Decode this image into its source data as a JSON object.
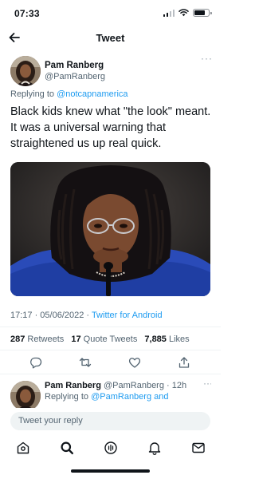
{
  "status_bar": {
    "time": "07:33"
  },
  "header": {
    "title": "Tweet"
  },
  "tweet": {
    "author_name": "Pam Ranberg",
    "author_handle": "@PamRanberg",
    "more": "···",
    "replying_prefix": "Replying to ",
    "replying_to": "@notcapnamerica",
    "text": "Black kids knew what \"the look\" meant. It was a universal warning that straightened us up real quick.",
    "timestamp": "17:17 · 05/06/2022 · ",
    "source": "Twitter for Android"
  },
  "stats": {
    "retweets_count": "287",
    "retweets_label": "Retweets",
    "quotes_count": "17",
    "quotes_label": "Quote Tweets",
    "likes_count": "7,885",
    "likes_label": "Likes"
  },
  "reply": {
    "author_name": "Pam Ranberg",
    "meta": "@PamRanberg · 12h",
    "more": "···",
    "replying_prefix": "Replying to ",
    "replying_to": "@PamRanberg and"
  },
  "reply_box": {
    "placeholder": "Tweet your reply"
  },
  "icons": {
    "back": "arrow-left-icon",
    "reply": "comment-icon",
    "retweet": "retweet-icon",
    "like": "heart-icon",
    "share": "share-icon",
    "home": "home-icon",
    "search": "search-icon",
    "spaces": "spaces-icon",
    "notifications": "bell-icon",
    "messages": "mail-icon"
  },
  "colors": {
    "accent": "#1d9bf0",
    "text": "#0f1419",
    "muted": "#536471"
  }
}
